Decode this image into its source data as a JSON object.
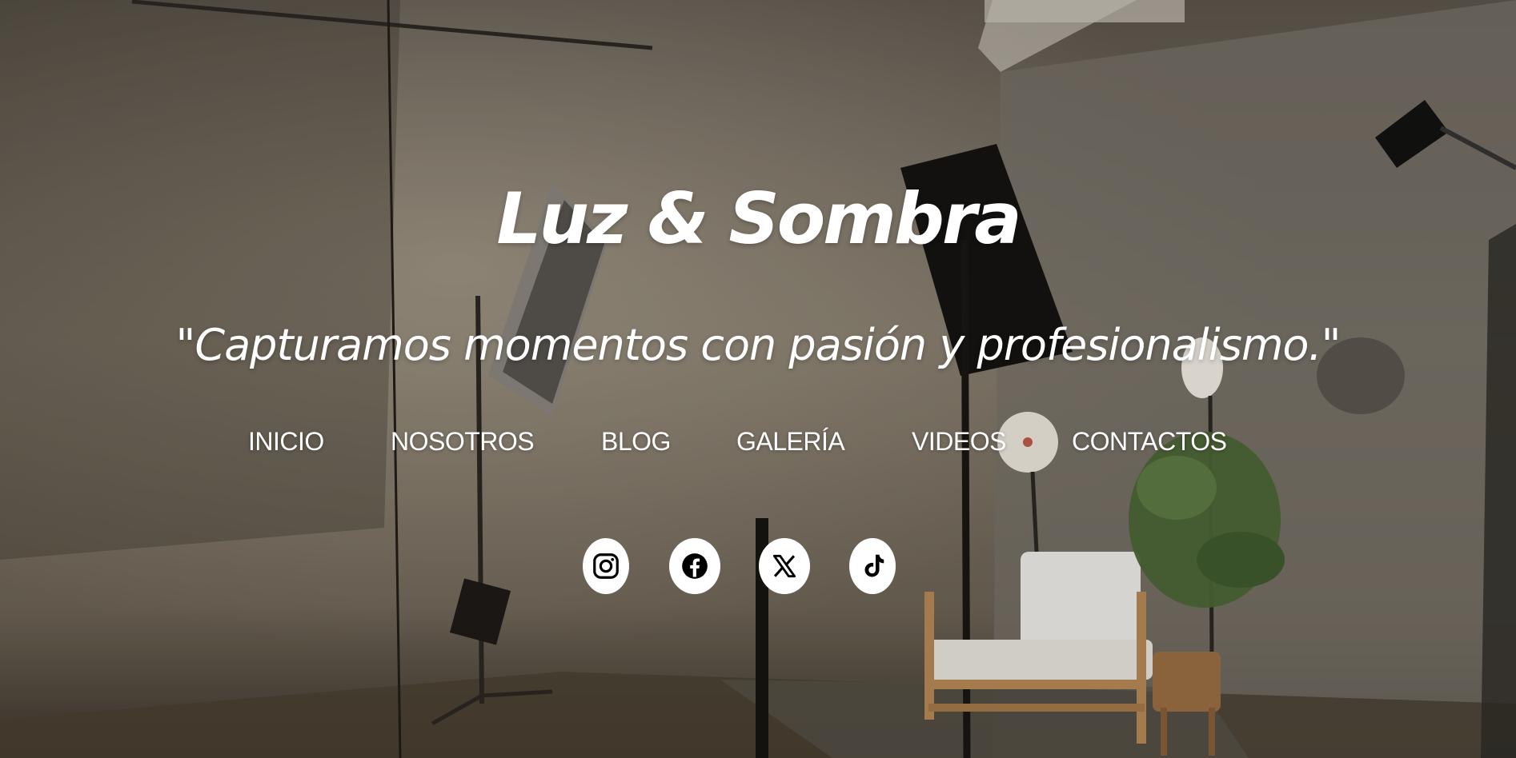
{
  "hero": {
    "title": "Luz & Sombra",
    "tagline": "\"Capturamos momentos con pasión y profesionalismo.\""
  },
  "nav": {
    "items": [
      {
        "label": "INICIO"
      },
      {
        "label": "NOSOTROS"
      },
      {
        "label": "BLOG"
      },
      {
        "label": "GALERÍA"
      },
      {
        "label": "VIDEOS"
      },
      {
        "label": "CONTACTOS"
      }
    ]
  },
  "social": {
    "icons": [
      "instagram-icon",
      "facebook-icon",
      "x-icon",
      "tiktok-icon"
    ]
  },
  "colors": {
    "text": "#ffffff",
    "icon_bg": "#ffffff",
    "icon_fg": "#000000"
  }
}
